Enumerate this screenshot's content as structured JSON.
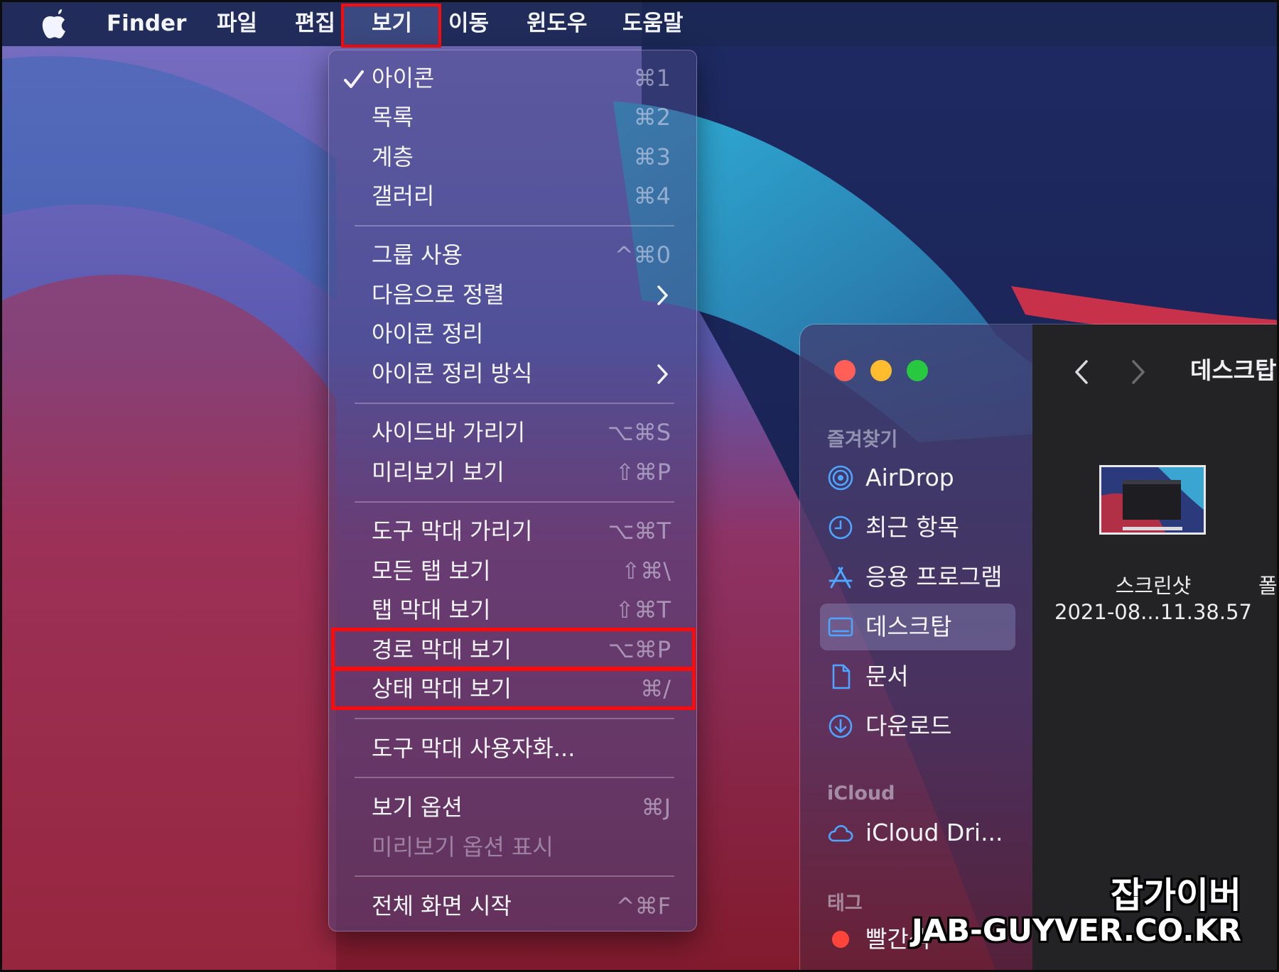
{
  "menubar": {
    "app_name": "Finder",
    "items": [
      "파일",
      "편집",
      "보기",
      "이동",
      "윈도우",
      "도움말"
    ],
    "open_menu": "보기"
  },
  "view_menu": {
    "items": [
      {
        "label": "아이콘",
        "shortcut": "⌘1",
        "checked": true
      },
      {
        "label": "목록",
        "shortcut": "⌘2"
      },
      {
        "label": "계층",
        "shortcut": "⌘3"
      },
      {
        "label": "갤러리",
        "shortcut": "⌘4"
      },
      {
        "label": "그룹 사용",
        "shortcut": "^⌘0"
      },
      {
        "label": "다음으로 정렬",
        "submenu": true
      },
      {
        "label": "아이콘 정리"
      },
      {
        "label": "아이콘 정리 방식",
        "submenu": true
      },
      {
        "label": "사이드바 가리기",
        "shortcut": "⌥⌘S"
      },
      {
        "label": "미리보기 보기",
        "shortcut": "⇧⌘P"
      },
      {
        "label": "도구 막대 가리기",
        "shortcut": "⌥⌘T"
      },
      {
        "label": "모든 탭 보기",
        "shortcut": "⇧⌘\\"
      },
      {
        "label": "탭 막대 보기",
        "shortcut": "⇧⌘T"
      },
      {
        "label": "경로 막대 보기",
        "shortcut": "⌥⌘P",
        "highlighted": true
      },
      {
        "label": "상태 막대 보기",
        "shortcut": "⌘/",
        "highlighted": true
      },
      {
        "label": "도구 막대 사용자화..."
      },
      {
        "label": "보기 옵션",
        "shortcut": "⌘J"
      },
      {
        "label": "미리보기 옵션 표시",
        "disabled": true
      },
      {
        "label": "전체 화면 시작",
        "shortcut": "^⌘F"
      }
    ]
  },
  "finder_window": {
    "title": "데스크탑",
    "sidebar": {
      "favorites_header": "즐겨찾기",
      "favorites": [
        {
          "label": "AirDrop",
          "icon": "airdrop-icon"
        },
        {
          "label": "최근 항목",
          "icon": "clock-icon"
        },
        {
          "label": "응용 프로그램",
          "icon": "apps-icon"
        },
        {
          "label": "데스크탑",
          "icon": "desktop-icon",
          "selected": true
        },
        {
          "label": "문서",
          "icon": "document-icon"
        },
        {
          "label": "다운로드",
          "icon": "download-icon"
        }
      ],
      "icloud_header": "iCloud",
      "icloud": [
        {
          "label": "iCloud Dri...",
          "icon": "cloud-icon"
        }
      ],
      "tags_header": "태그",
      "tags": [
        {
          "label": "빨간색",
          "color": "#ff453a"
        }
      ]
    },
    "files": [
      {
        "name_line1": "스크린샷",
        "name_line2": "2021-08...11.38.57"
      },
      {
        "name_line1": "폴더"
      }
    ]
  },
  "watermark": {
    "korean": "잡가이버",
    "url": "JAB-GUYVER.CO.KR"
  },
  "colors": {
    "highlight_box": "#ff0a0a",
    "traffic_red": "#ff5f57",
    "traffic_yellow": "#febc2e",
    "traffic_green": "#28c840"
  }
}
